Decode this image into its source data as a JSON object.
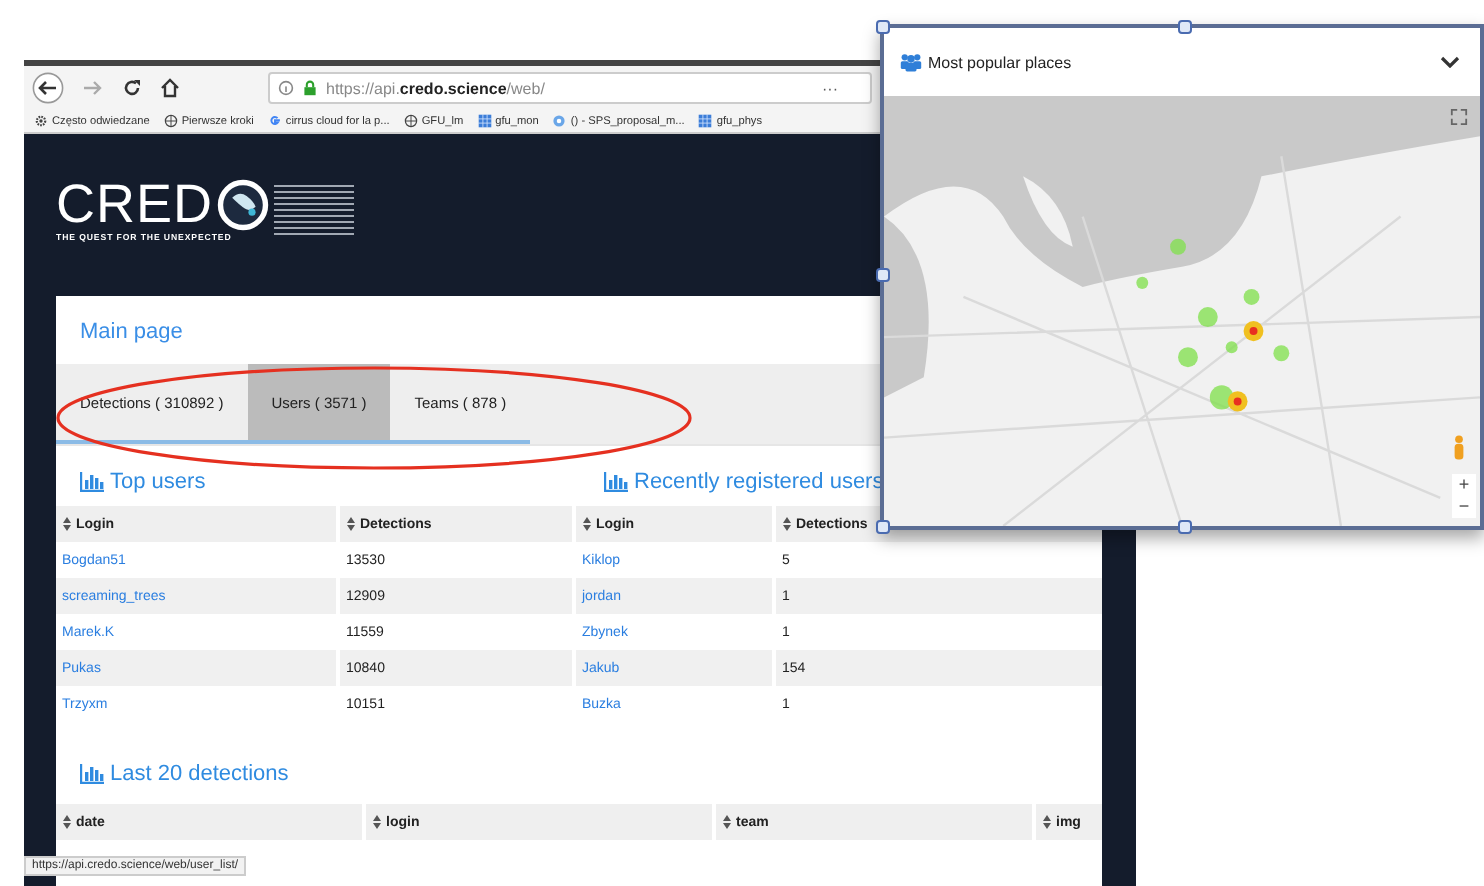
{
  "browser": {
    "url": "https://api.**credo.science**/web/",
    "menu": "···",
    "bookmarks": [
      {
        "label": "Często odwiedzane",
        "kind": "gear"
      },
      {
        "label": "Pierwsze kroki",
        "kind": "globe"
      },
      {
        "label": "cirrus cloud for la p...",
        "kind": "google"
      },
      {
        "label": "GFU_lm",
        "kind": "globe"
      },
      {
        "label": "gfu_mon",
        "kind": "grid"
      },
      {
        "label": "() - SPS_proposal_m...",
        "kind": "drop"
      },
      {
        "label": "gfu_phys",
        "kind": "grid"
      }
    ],
    "status_url": "https://api.credo.science/web/user_list/"
  },
  "logo": {
    "text": "CRED",
    "tagline": "THE QUEST FOR THE UNEXPECTED"
  },
  "card": {
    "title": "Main page",
    "tabs": [
      {
        "label": "Detections ( 310892 )",
        "selected": false
      },
      {
        "label": "Users ( 3571 )",
        "selected": true
      },
      {
        "label": "Teams ( 878 )",
        "selected": false
      }
    ],
    "top_users": {
      "title": "Top users",
      "columns": [
        "Login",
        "Detections"
      ],
      "rows": [
        [
          "Bogdan51",
          "13530"
        ],
        [
          "screaming_trees",
          "12909"
        ],
        [
          "Marek.K",
          "11559"
        ],
        [
          "Pukas",
          "10840"
        ],
        [
          "Trzyxm",
          "10151"
        ]
      ]
    },
    "recent_users": {
      "title": "Recently registered users",
      "columns": [
        "Login",
        "Detections"
      ],
      "rows": [
        [
          "Kiklop",
          "5"
        ],
        [
          "jordan",
          "1"
        ],
        [
          "Zbynek",
          "1"
        ],
        [
          "Jakub",
          "154"
        ],
        [
          "Buzka",
          "1"
        ]
      ]
    },
    "last_detections": {
      "title": "Last 20 detections",
      "columns": [
        "date",
        "login",
        "team",
        "img"
      ]
    }
  },
  "map_window": {
    "title": "Most popular places",
    "zoom_in": "+",
    "zoom_out": "−"
  }
}
